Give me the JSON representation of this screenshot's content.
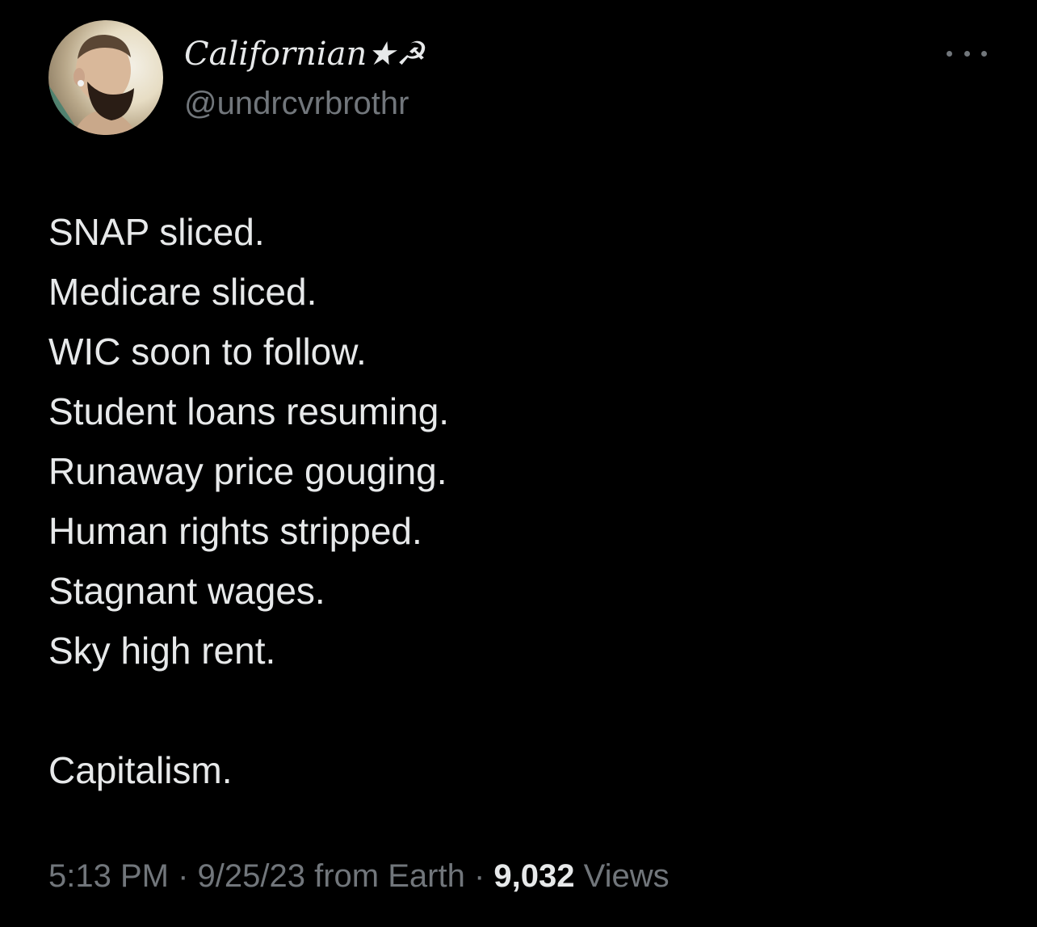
{
  "author": {
    "display_name": "Californian★☭",
    "handle": "@undrcvrbrothr"
  },
  "more_menu_icon": "more-horizontal-icon",
  "tweet": {
    "lines": [
      "SNAP sliced.",
      "Medicare sliced.",
      "WIC soon to follow.",
      "Student loans resuming.",
      "Runaway price gouging.",
      "Human rights stripped.",
      "Stagnant wages.",
      "Sky high rent."
    ],
    "closing": "Capitalism."
  },
  "meta": {
    "time": "5:13 PM",
    "separator": "·",
    "date_source": "9/25/23 from Earth",
    "views_count": "9,032",
    "views_label": "Views"
  },
  "colors": {
    "background": "#000000",
    "primary_text": "#e7e9ea",
    "secondary_text": "#71767b"
  }
}
